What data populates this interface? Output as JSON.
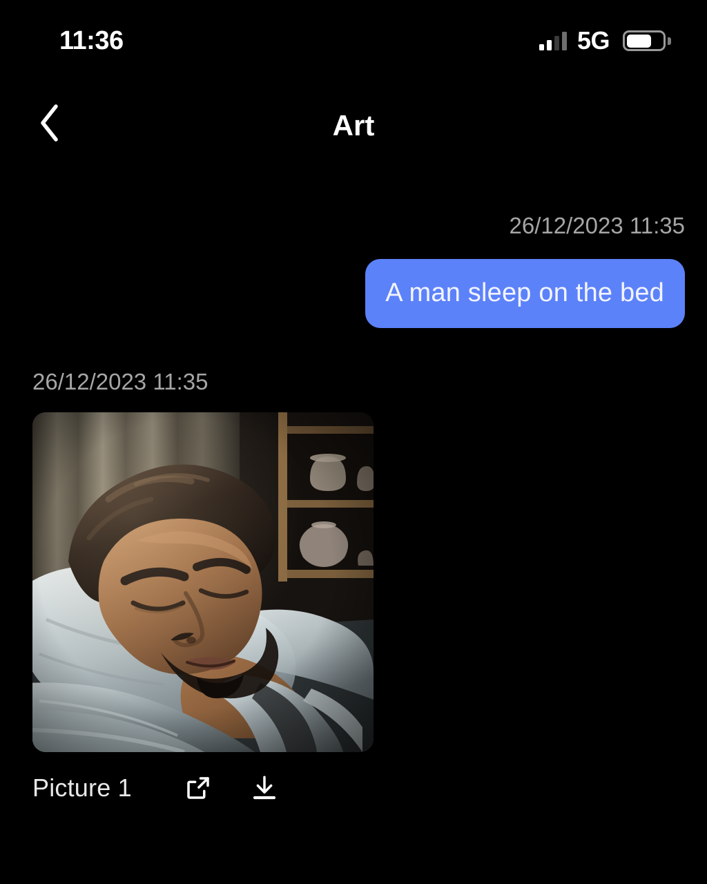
{
  "status_bar": {
    "time": "11:36",
    "network_label": "5G",
    "signal_icon": "signal-bars-icon",
    "signal_bars_filled": 2,
    "signal_bars_total": 4,
    "battery_icon": "battery-icon",
    "battery_percent": 70
  },
  "nav": {
    "back_icon": "chevron-left-icon",
    "title": "Art"
  },
  "conversation": {
    "outgoing": {
      "timestamp": "26/12/2023 11:35",
      "text": "A man sleep on the bed",
      "bubble_color": "#5c82fa",
      "text_color": "#f2f4fe"
    },
    "incoming": {
      "timestamp": "26/12/2023 11:35",
      "attachment": {
        "caption": "Picture 1",
        "alt": "A man sleeping on a bed with white sheets, curtains and a wooden shelf with ceramic bowls behind him",
        "share_icon": "external-link-icon",
        "download_icon": "download-icon"
      }
    }
  },
  "colors": {
    "background": "#000000",
    "accent": "#5c82fa",
    "timestamp_text": "#a6a6a6",
    "primary_text": "#ffffff"
  }
}
